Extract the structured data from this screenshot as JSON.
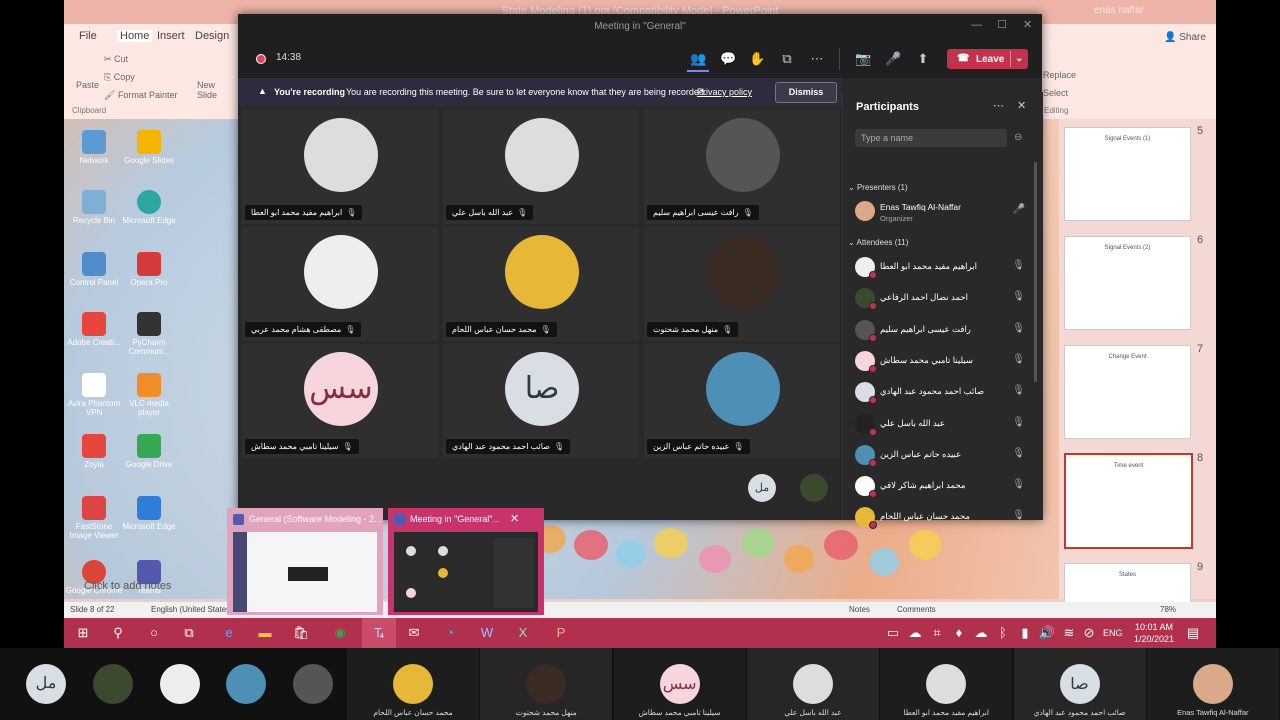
{
  "powerpoint": {
    "title": "State Modeling (1).ppt [Compatibility Mode] - PowerPoint",
    "user": "enas naffar",
    "tabs": [
      "File",
      "Home",
      "Insert",
      "Design"
    ],
    "share": "Share",
    "ribbon": {
      "cut": "Cut",
      "copy": "Copy",
      "format_painter": "Format Painter",
      "paste": "Paste",
      "clipboard": "Clipboard",
      "new_slide": "New Slide",
      "replace": "Replace",
      "select": "Select",
      "editing": "Editing"
    },
    "notes_placeholder": "Click to add notes",
    "status": {
      "slide": "Slide 8 of 22",
      "language": "English (United States)",
      "notes": "Notes",
      "comments": "Comments",
      "zoom": "78%"
    },
    "thumbs": [
      {
        "num": "5",
        "title": "Signal Events (1)"
      },
      {
        "num": "6",
        "title": "Signal Events (2)"
      },
      {
        "num": "7",
        "title": "Change Event"
      },
      {
        "num": "8",
        "title": "Time event"
      },
      {
        "num": "9",
        "title": "States"
      }
    ],
    "desktop_icons": [
      "Network",
      "Google Slides",
      "Recycle Bin",
      "Microsoft Edge",
      "Control Panel",
      "Opera Pro",
      "Adobe Creati...",
      "PyCharm Communi...",
      "Avira Phantom VPN",
      "VLC media player",
      "Zoyla",
      "Google Drive",
      "FastStone Image Viewer",
      "Microsoft Edge",
      "Google Chrome",
      "Teams"
    ]
  },
  "teams": {
    "window_title": "Meeting in \"General\"",
    "timer": "14:38",
    "leave_label": "Leave",
    "recording": {
      "bold": "You're recording",
      "text": "You are recording this meeting. Be sure to let everyone know that they are being recorded.",
      "link": "Privacy policy",
      "dismiss": "Dismiss"
    },
    "tiles": [
      {
        "name": "ابراهيم مفيد محمد ابو العطا",
        "kind": "photo",
        "color": "#ddd"
      },
      {
        "name": "عبد الله باسل علي",
        "kind": "photo",
        "color": "#ddd"
      },
      {
        "name": "رافت عيسى ابراهيم سليم",
        "kind": "photo",
        "color": "#555"
      },
      {
        "name": "مصطفى هشام محمد عربي",
        "kind": "photo",
        "color": "#eee"
      },
      {
        "name": "محمد حسان عباس اللحام",
        "kind": "photo",
        "color": "#e7b838"
      },
      {
        "name": "منهل محمد شحتوت",
        "kind": "photo",
        "color": "#3a2b25"
      },
      {
        "name": "سيلينا تامبي محمد سطاش",
        "kind": "initials",
        "initials": "سس",
        "color": "#f6d5dd",
        "fg": "#8a2b3e"
      },
      {
        "name": "صائب احمد محمود عبد الهادي",
        "kind": "initials",
        "initials": "صا",
        "color": "#d8dee3",
        "fg": "#2b3a44"
      },
      {
        "name": "عبيده حاتم عباس الزين",
        "kind": "photo",
        "color": "#4d8fb5"
      }
    ],
    "bottom_initials": "مل",
    "participants": {
      "title": "Participants",
      "search_placeholder": "Type a name",
      "presenters_header": "Presenters (1)",
      "presenter": {
        "name": "Enas Tawfiq Al-Naffar",
        "role": "Organizer"
      },
      "attendees_header": "Attendees (11)",
      "attendees": [
        "ابراهيم مفيد محمد ابو العطا",
        "احمد نضال احمد الرفاعي",
        "رافت عيسى ابراهيم سليم",
        "سيلينا تامبي محمد سطاش",
        "صائب احمد محمود عبد الهادي",
        "عبد الله باسل علي",
        "عبيده حاتم عباس الزين",
        "محمد ابراهيم شاكر لافي",
        "محمد حسان عباس اللحام"
      ]
    }
  },
  "taskbar_previews": [
    {
      "title": "General (Software Modeling - 2..."
    },
    {
      "title": "Meeting in \"General\"..."
    }
  ],
  "taskbar": {
    "language": "ENG",
    "time": "10:01 AM",
    "date": "1/20/2021",
    "teams_badge": "4"
  },
  "filmstrip": {
    "initials_left": "مل",
    "tiles": [
      {
        "name": "محمد حسان عباس اللحام",
        "kind": "photo",
        "color": "#e7b838"
      },
      {
        "name": "منهل محمد شحتوت",
        "kind": "photo",
        "color": "#3a2b25"
      },
      {
        "name": "سيلينا تامبي محمد سطاش",
        "kind": "initials",
        "initials": "سس",
        "color": "#f6d5dd",
        "fg": "#8a2b3e"
      },
      {
        "name": "عبد الله باسل علي",
        "kind": "photo",
        "color": "#ddd"
      },
      {
        "name": "ابراهيم مفيد محمد ابو العطا",
        "kind": "photo",
        "color": "#ddd"
      },
      {
        "name": "صائب احمد محمود عبد الهادي",
        "kind": "initials",
        "initials": "صا",
        "color": "#d8dee3",
        "fg": "#2b3a44"
      },
      {
        "name": "Enas Tawfiq Al-Naffar",
        "kind": "photo",
        "color": "#d9a98a"
      }
    ]
  }
}
